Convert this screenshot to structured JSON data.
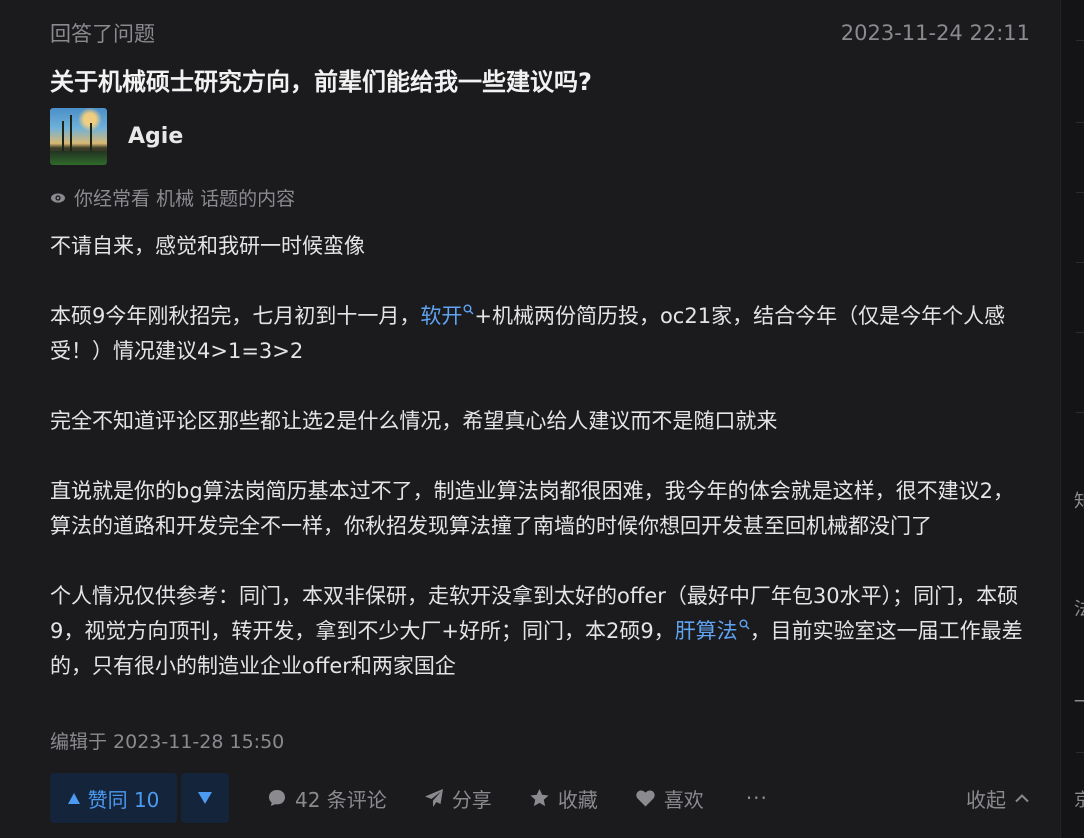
{
  "header": {
    "activity": "回答了问题",
    "timestamp": "2023-11-24 22:11"
  },
  "question": {
    "title": "关于机械硕士研究方向，前辈们能给我一些建议吗?"
  },
  "author": {
    "name": "Agie",
    "avatar_icon": "avatar-photo"
  },
  "topic_hint": {
    "icon": "eye-icon",
    "text": "你经常看 机械 话题的内容"
  },
  "answer": {
    "p1": "不请自来，感觉和我研一时候蛮像",
    "p2_before": "本硕9今年刚秋招完，七月初到十一月，",
    "p2_link": "软开",
    "p2_after": "+机械两份简历投，oc21家，结合今年（仅是今年个人感受！）情况建议4>1=3>2",
    "p3": "完全不知道评论区那些都让选2是什么情况，希望真心给人建议而不是随口就来",
    "p4": "直说就是你的bg算法岗简历基本过不了，制造业算法岗都很困难，我今年的体会就是这样，很不建议2，算法的道路和开发完全不一样，你秋招发现算法撞了南墙的时候你想回开发甚至回机械都没门了",
    "p5_before": "个人情况仅供参考：同门，本双非保研，走软开没拿到太好的offer（最好中厂年包30水平）；同门，本硕9，视觉方向顶刊，转开发，拿到不少大厂+好所；同门，本2硕9，",
    "p5_link": "肝算法",
    "p5_after": "，目前实验室这一届工作最差的，只有很小的制造业企业offer和两家国企"
  },
  "edited": "编辑于 2023-11-28 15:50",
  "actions": {
    "vote_up": "赞同 10",
    "comments": "42 条评论",
    "share": "分享",
    "favorite": "收藏",
    "like": "喜欢",
    "more": "···",
    "collapse": "收起"
  },
  "side_rail": {
    "frag1": "知",
    "frag2": "法",
    "frag3": "一",
    "frag4": "京"
  },
  "colors": {
    "background": "#1b1b1d",
    "link": "#5fa3f2",
    "vote_bg": "#14243a",
    "vote_fg": "#4d9af2",
    "muted": "#8a8a8f"
  }
}
